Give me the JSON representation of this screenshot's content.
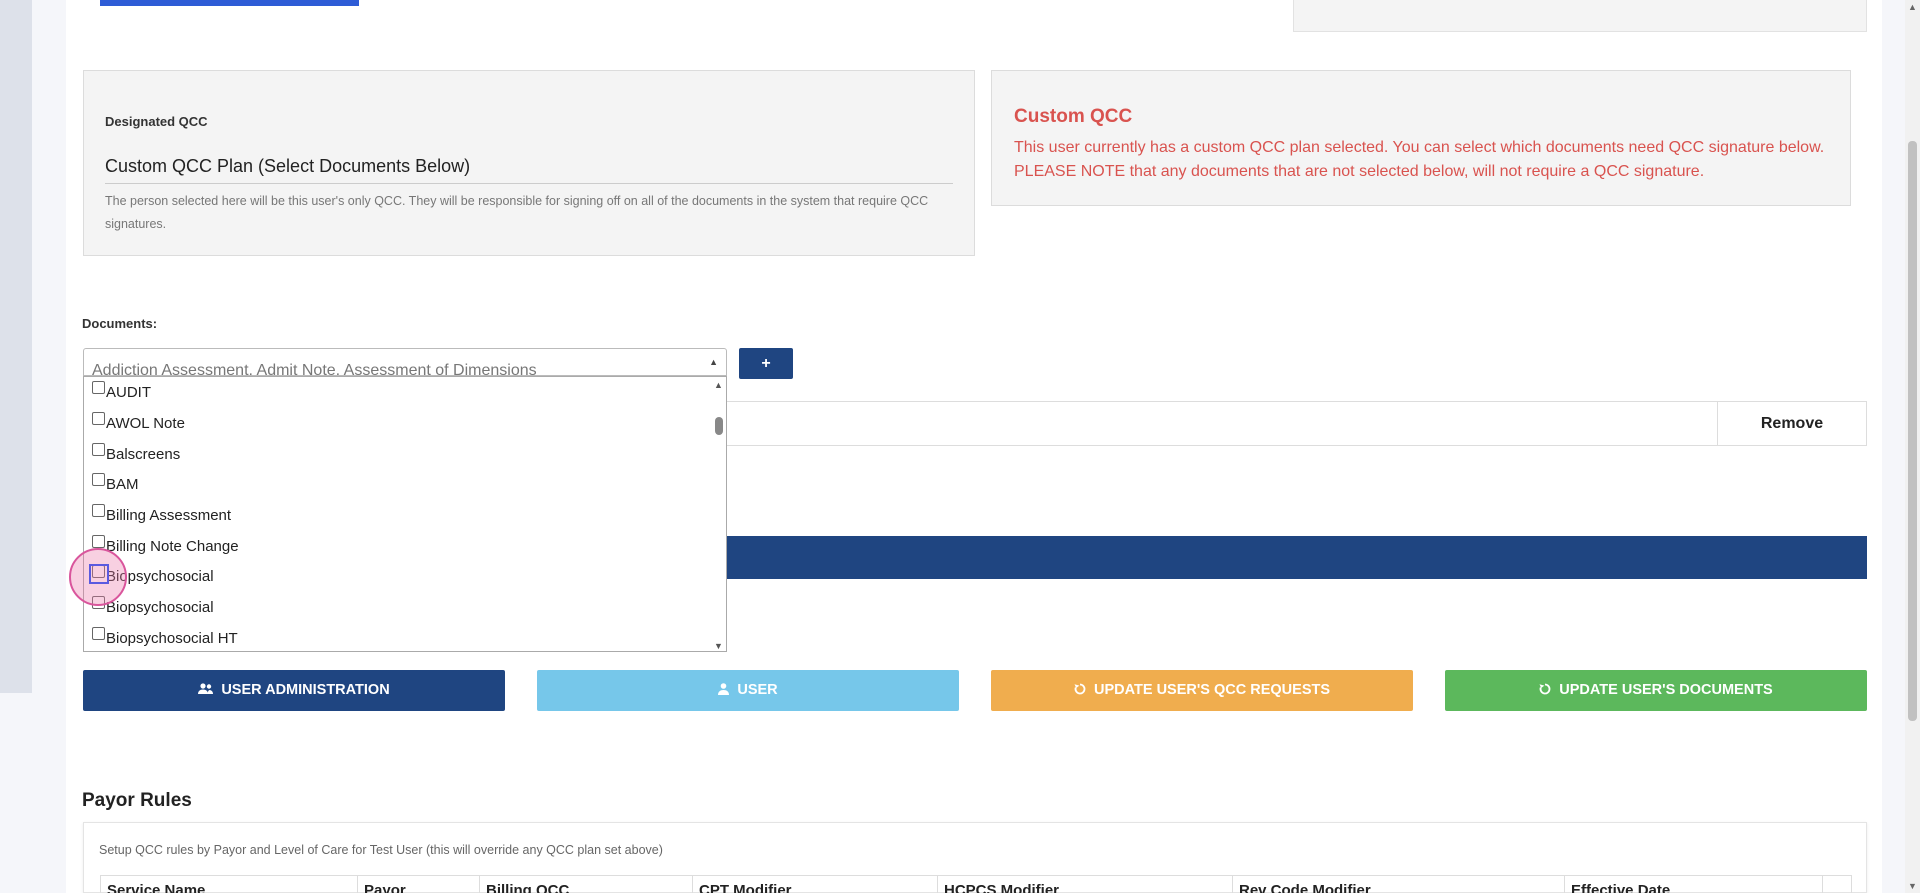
{
  "qcc": {
    "label": "Designated QCC",
    "value": "Custom QCC Plan (Select Documents Below)",
    "help": "The person selected here will be this user's only QCC. They will be responsible for signing off on all of the documents in the system that require QCC signatures."
  },
  "custom_qcc": {
    "title": "Custom QCC",
    "message": "This user currently has a custom QCC plan selected. You can select which documents need QCC signature below. PLEASE NOTE that any documents that are not selected below, will not require a QCC signature."
  },
  "documents": {
    "label": "Documents:",
    "selected_text": "Addiction Assessment, Admit Note, Assessment of Dimensions",
    "add_label": "+",
    "options": [
      {
        "label": "AUDIT",
        "checked": false
      },
      {
        "label": "AWOL Note",
        "checked": false
      },
      {
        "label": "Balscreens",
        "checked": false
      },
      {
        "label": "BAM",
        "checked": false
      },
      {
        "label": "Billing Assessment",
        "checked": false
      },
      {
        "label": "Billing Note Change",
        "checked": false
      },
      {
        "label": "Biopsychosocial",
        "checked": false
      },
      {
        "label": "Biopsychosocial",
        "checked": false
      },
      {
        "label": "Biopsychosocial HT",
        "checked": false
      }
    ]
  },
  "table": {
    "remove_header": "Remove"
  },
  "actions": {
    "user_admin": "USER ADMINISTRATION",
    "user": "USER",
    "update_qcc": "UPDATE USER'S QCC REQUESTS",
    "update_docs": "UPDATE USER'S DOCUMENTS"
  },
  "payor": {
    "title": "Payor Rules",
    "description": "Setup QCC rules by Payor and Level of Care for Test User (this will override any QCC plan set above)",
    "columns": [
      "Service Name",
      "Payor",
      "Billing QCC",
      "CPT Modifier",
      "HCPCS Modifier",
      "Rev Code Modifier",
      "Effective Date",
      ""
    ]
  },
  "colors": {
    "navy": "#1f4581",
    "light_blue": "#76c7ea",
    "orange": "#f0ad4e",
    "green": "#5cb85c",
    "red_text": "#d9534f"
  },
  "icons": {
    "user_admin": "users-icon",
    "user": "user-icon",
    "refresh": "refresh-icon"
  }
}
